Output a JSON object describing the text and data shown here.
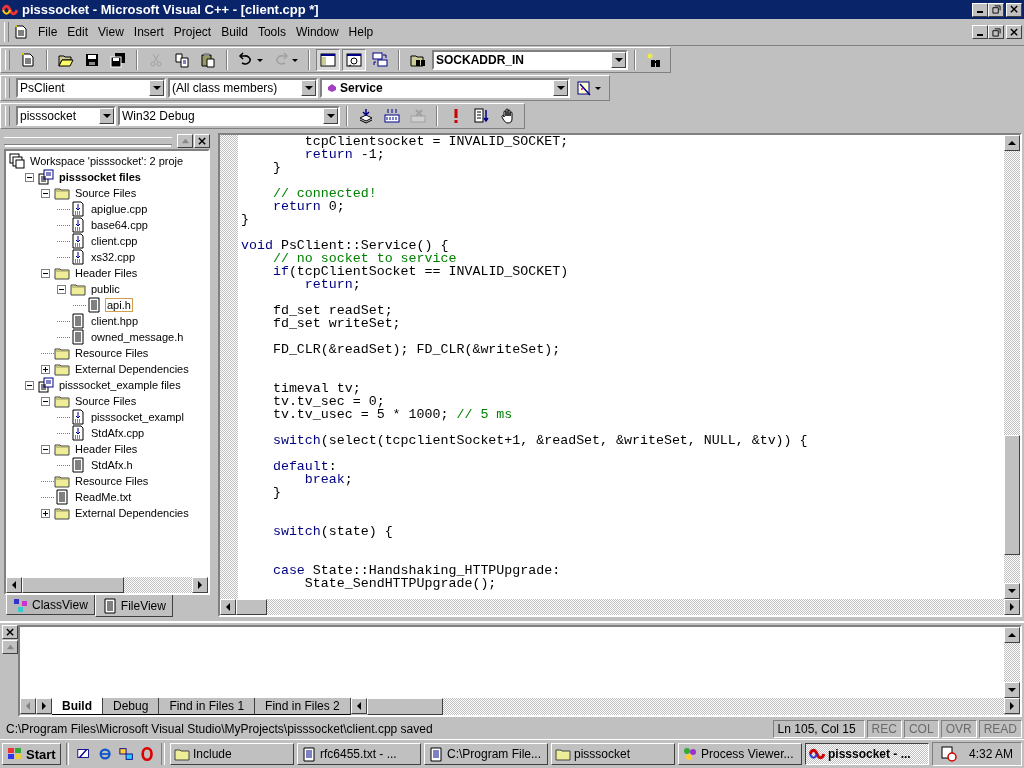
{
  "window": {
    "title": "pisssocket - Microsoft Visual C++ - [client.cpp *]"
  },
  "menu": [
    "File",
    "Edit",
    "View",
    "Insert",
    "Project",
    "Build",
    "Tools",
    "Window",
    "Help"
  ],
  "toolbars": [
    {
      "items": [
        {
          "kind": "button",
          "pressed": false,
          "disabled": false
        },
        {
          "kind": "separator"
        },
        {
          "kind": "button",
          "pressed": false,
          "disabled": false
        },
        {
          "kind": "button",
          "pressed": false,
          "disabled": false
        },
        {
          "kind": "button",
          "pressed": false,
          "disabled": false
        },
        {
          "kind": "separator"
        },
        {
          "kind": "button",
          "pressed": false,
          "disabled": true
        },
        {
          "kind": "button",
          "pressed": false,
          "disabled": false
        },
        {
          "kind": "button",
          "pressed": false,
          "disabled": false
        },
        {
          "kind": "separator"
        },
        {
          "kind": "menu-button",
          "pressed": false,
          "disabled": false
        },
        {
          "kind": "menu-button",
          "pressed": false,
          "disabled": true
        },
        {
          "kind": "separator"
        },
        {
          "kind": "button",
          "pressed": true,
          "disabled": false
        },
        {
          "kind": "button",
          "pressed": true,
          "disabled": false
        },
        {
          "kind": "button",
          "pressed": false,
          "disabled": false
        },
        {
          "kind": "separator"
        },
        {
          "kind": "button",
          "pressed": false,
          "disabled": false
        },
        {
          "kind": "combo",
          "value": "SOCKADDR_IN"
        },
        {
          "kind": "separator"
        },
        {
          "kind": "button",
          "pressed": false,
          "disabled": false
        }
      ]
    },
    {
      "items": [
        {
          "kind": "combo",
          "value": "PsClient"
        },
        {
          "kind": "combo",
          "value": "(All class members)"
        },
        {
          "kind": "combo",
          "value": "Service"
        },
        {
          "kind": "menu-button",
          "pressed": false,
          "disabled": false
        }
      ]
    },
    {
      "items": [
        {
          "kind": "combo",
          "value": "pisssocket"
        },
        {
          "kind": "combo",
          "value": "Win32 Debug"
        },
        {
          "kind": "separator"
        },
        {
          "kind": "button",
          "pressed": false,
          "disabled": false
        },
        {
          "kind": "button",
          "pressed": false,
          "disabled": false
        },
        {
          "kind": "button",
          "pressed": false,
          "disabled": true
        },
        {
          "kind": "separator"
        },
        {
          "kind": "button",
          "pressed": false,
          "disabled": false
        },
        {
          "kind": "button",
          "pressed": false,
          "disabled": false
        },
        {
          "kind": "button",
          "pressed": false,
          "disabled": false
        }
      ]
    }
  ],
  "workspace": {
    "tree": [
      {
        "label": "Workspace 'pisssocket': 2 proje",
        "kind": "workspace",
        "selected": false,
        "children": [
          {
            "label": "pisssocket files",
            "kind": "project",
            "active": true,
            "expanded": true,
            "selected": false,
            "children": [
              {
                "label": "Source Files",
                "kind": "folder",
                "expanded": true,
                "selected": false,
                "children": [
                  {
                    "label": "apiglue.cpp",
                    "kind": "source",
                    "selected": false
                  },
                  {
                    "label": "base64.cpp",
                    "kind": "source",
                    "selected": false
                  },
                  {
                    "label": "client.cpp",
                    "kind": "source",
                    "selected": false
                  },
                  {
                    "label": "xs32.cpp",
                    "kind": "source",
                    "selected": false
                  }
                ]
              },
              {
                "label": "Header Files",
                "kind": "folder",
                "expanded": true,
                "selected": false,
                "children": [
                  {
                    "label": "public",
                    "kind": "folder",
                    "expanded": true,
                    "selected": false,
                    "children": [
                      {
                        "label": "api.h",
                        "kind": "header",
                        "selected": true
                      }
                    ]
                  },
                  {
                    "label": "client.hpp",
                    "kind": "header",
                    "selected": false
                  },
                  {
                    "label": "owned_message.h",
                    "kind": "header",
                    "selected": false
                  }
                ]
              },
              {
                "label": "Resource Files",
                "kind": "folder",
                "selected": false
              },
              {
                "label": "External Dependencies",
                "kind": "folder",
                "expanded": false,
                "selected": false
              }
            ]
          },
          {
            "label": "pisssocket_example files",
            "kind": "project",
            "active": false,
            "expanded": true,
            "selected": false,
            "children": [
              {
                "label": "Source Files",
                "kind": "folder",
                "expanded": true,
                "selected": false,
                "children": [
                  {
                    "label": "pisssocket_exampl",
                    "kind": "source",
                    "selected": false
                  },
                  {
                    "label": "StdAfx.cpp",
                    "kind": "source",
                    "selected": false
                  }
                ]
              },
              {
                "label": "Header Files",
                "kind": "folder",
                "expanded": true,
                "selected": false,
                "children": [
                  {
                    "label": "StdAfx.h",
                    "kind": "header",
                    "selected": false
                  }
                ]
              },
              {
                "label": "Resource Files",
                "kind": "folder",
                "selected": false
              },
              {
                "label": "ReadMe.txt",
                "kind": "text",
                "selected": false
              },
              {
                "label": "External Dependencies",
                "kind": "folder",
                "expanded": false,
                "selected": false
              }
            ]
          }
        ]
      }
    ],
    "tabs": [
      {
        "label": "ClassView",
        "selected": false
      },
      {
        "label": "FileView",
        "selected": true
      }
    ]
  },
  "editor": {
    "lines": [
      {
        "kind": "code",
        "segments": [
          {
            "kind": "plain",
            "text": "        tcpClientsocket = INVALID_SOCKET;"
          }
        ]
      },
      {
        "kind": "code",
        "segments": [
          {
            "kind": "keyword",
            "text": "        return"
          },
          {
            "kind": "plain",
            "text": " -1;"
          }
        ]
      },
      {
        "kind": "code",
        "segments": [
          {
            "kind": "plain",
            "text": "    }"
          }
        ]
      },
      {
        "kind": "blank"
      },
      {
        "kind": "code",
        "segments": [
          {
            "kind": "comment",
            "text": "    // connected!"
          }
        ]
      },
      {
        "kind": "code",
        "segments": [
          {
            "kind": "keyword",
            "text": "    return"
          },
          {
            "kind": "plain",
            "text": " 0;"
          }
        ]
      },
      {
        "kind": "code",
        "segments": [
          {
            "kind": "plain",
            "text": "}"
          }
        ]
      },
      {
        "kind": "blank"
      },
      {
        "kind": "code",
        "segments": [
          {
            "kind": "keyword",
            "text": "void"
          },
          {
            "kind": "plain",
            "text": " PsClient::Service() {"
          }
        ]
      },
      {
        "kind": "code",
        "segments": [
          {
            "kind": "comment",
            "text": "    // no socket to service"
          }
        ]
      },
      {
        "kind": "code",
        "segments": [
          {
            "kind": "keyword",
            "text": "    if"
          },
          {
            "kind": "plain",
            "text": "(tcpClientSocket == INVALID_SOCKET)"
          }
        ]
      },
      {
        "kind": "code",
        "segments": [
          {
            "kind": "keyword",
            "text": "        return"
          },
          {
            "kind": "plain",
            "text": ";"
          }
        ]
      },
      {
        "kind": "blank"
      },
      {
        "kind": "code",
        "segments": [
          {
            "kind": "plain",
            "text": "    fd_set readSet;"
          }
        ]
      },
      {
        "kind": "code",
        "segments": [
          {
            "kind": "plain",
            "text": "    fd_set writeSet;"
          }
        ]
      },
      {
        "kind": "blank"
      },
      {
        "kind": "code",
        "segments": [
          {
            "kind": "plain",
            "text": "    FD_CLR(&readSet); FD_CLR(&writeSet);"
          }
        ]
      },
      {
        "kind": "blank"
      },
      {
        "kind": "blank"
      },
      {
        "kind": "code",
        "segments": [
          {
            "kind": "plain",
            "text": "    timeval tv;"
          }
        ]
      },
      {
        "kind": "code",
        "segments": [
          {
            "kind": "plain",
            "text": "    tv.tv_sec = 0;"
          }
        ]
      },
      {
        "kind": "code",
        "segments": [
          {
            "kind": "plain",
            "text": "    tv.tv_usec = 5 * 1000; "
          },
          {
            "kind": "comment",
            "text": "// 5 ms"
          }
        ]
      },
      {
        "kind": "blank"
      },
      {
        "kind": "code",
        "segments": [
          {
            "kind": "keyword",
            "text": "    switch"
          },
          {
            "kind": "plain",
            "text": "(select(tcpclientSocket+1, &readSet, &writeSet, NULL, &tv)) {"
          }
        ]
      },
      {
        "kind": "blank"
      },
      {
        "kind": "code",
        "segments": [
          {
            "kind": "keyword",
            "text": "    default"
          },
          {
            "kind": "plain",
            "text": ":"
          }
        ]
      },
      {
        "kind": "code",
        "segments": [
          {
            "kind": "keyword",
            "text": "        break"
          },
          {
            "kind": "plain",
            "text": ";"
          }
        ]
      },
      {
        "kind": "code",
        "segments": [
          {
            "kind": "plain",
            "text": "    }"
          }
        ]
      },
      {
        "kind": "blank"
      },
      {
        "kind": "blank"
      },
      {
        "kind": "code",
        "segments": [
          {
            "kind": "keyword",
            "text": "    switch"
          },
          {
            "kind": "plain",
            "text": "(state) {"
          }
        ]
      },
      {
        "kind": "blank"
      },
      {
        "kind": "blank"
      },
      {
        "kind": "code",
        "segments": [
          {
            "kind": "keyword",
            "text": "    case"
          },
          {
            "kind": "plain",
            "text": " State::Handshaking_HTTPUpgrade:"
          }
        ]
      },
      {
        "kind": "code",
        "segments": [
          {
            "kind": "plain",
            "text": "        State_SendHTTPUpgrade();"
          }
        ]
      }
    ]
  },
  "output": {
    "tabs": [
      {
        "label": "Build",
        "selected": true
      },
      {
        "label": "Debug",
        "selected": false
      },
      {
        "label": "Find in Files 1",
        "selected": false
      },
      {
        "label": "Find in Files 2",
        "selected": false
      }
    ]
  },
  "status_bar": {
    "message": "C:\\Program Files\\Microsoft Visual Studio\\MyProjects\\pisssocket\\client.cpp saved",
    "position": "Ln 105, Col 15",
    "indicators": [
      {
        "label": "REC",
        "on": false
      },
      {
        "label": "COL",
        "on": false
      },
      {
        "label": "OVR",
        "on": false
      },
      {
        "label": "READ",
        "on": false
      }
    ]
  },
  "taskbar": {
    "start": "Start",
    "tasks": [
      {
        "label": "Include",
        "kind": "folder",
        "selected": false
      },
      {
        "label": "rfc6455.txt - ...",
        "kind": "notepad",
        "selected": false
      },
      {
        "label": "C:\\Program File...",
        "kind": "notepad",
        "selected": false
      },
      {
        "label": "pisssocket",
        "kind": "folder",
        "selected": false
      },
      {
        "label": "Process Viewer...",
        "kind": "viewer",
        "selected": false
      },
      {
        "label": "pisssocket - ...",
        "kind": "ide",
        "selected": true
      }
    ],
    "clock": "4:32 AM"
  }
}
